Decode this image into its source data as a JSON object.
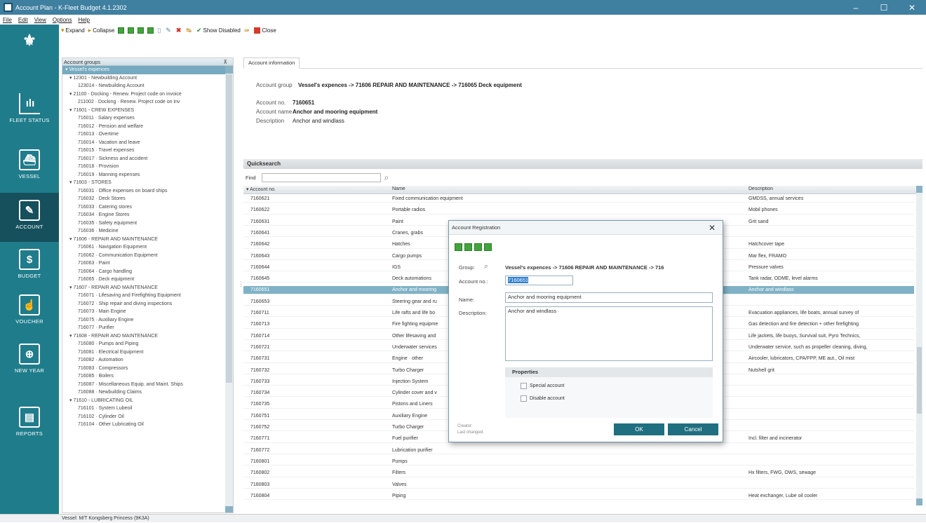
{
  "window": {
    "title": "Account Plan - K-Fleet Budget 4.1.2302",
    "minimize": "–",
    "maximize": "☐",
    "close": "✕"
  },
  "menu": [
    "File",
    "Edit",
    "View",
    "Options",
    "Help"
  ],
  "toolbar": {
    "expand": "Expand",
    "collapse": "Collapse",
    "show_disabled": "Show Disabled",
    "close": "Close"
  },
  "sidebar": [
    {
      "label": "",
      "icon": "crest-icon"
    },
    {
      "label": "FLEET STATUS",
      "icon": "fleet-status-icon"
    },
    {
      "label": "VESSEL",
      "icon": "vessel-icon"
    },
    {
      "label": "ACCOUNT",
      "icon": "account-icon"
    },
    {
      "label": "BUDGET",
      "icon": "budget-icon"
    },
    {
      "label": "VOUCHER",
      "icon": "voucher-icon"
    },
    {
      "label": "NEW YEAR",
      "icon": "new-year-icon"
    },
    {
      "label": "REPORTS",
      "icon": "reports-icon"
    }
  ],
  "tree": {
    "header": "Account groups",
    "pin": "⊼",
    "nodes": [
      {
        "indent": 0,
        "label": "▾ Vessel's expences",
        "selected": true
      },
      {
        "indent": 1,
        "label": "▾ 12301 - Newbuilding Account"
      },
      {
        "indent": 3,
        "label": "123014 - Newbuilding Account"
      },
      {
        "indent": 1,
        "label": "▾ 21100 - Docking - Renew. Project code on invoice"
      },
      {
        "indent": 3,
        "label": "211002 · Docking · Renew. Project code on inv"
      },
      {
        "indent": 1,
        "label": "▾ 71601 - CREW EXPENSES"
      },
      {
        "indent": 3,
        "label": "716011 · Salary expenses"
      },
      {
        "indent": 3,
        "label": "716012 · Pension and welfare"
      },
      {
        "indent": 3,
        "label": "716013 · Overtime"
      },
      {
        "indent": 3,
        "label": "716014 · Vacation and leave"
      },
      {
        "indent": 3,
        "label": "716015 · Travel expenses"
      },
      {
        "indent": 3,
        "label": "716017 · Sickness and accident"
      },
      {
        "indent": 3,
        "label": "716018 · Provision"
      },
      {
        "indent": 3,
        "label": "716019 · Manning expenses"
      },
      {
        "indent": 1,
        "label": "▾ 71603 - STORES"
      },
      {
        "indent": 3,
        "label": "716031 · Office expenses on board ships"
      },
      {
        "indent": 3,
        "label": "716032 · Deck Stores"
      },
      {
        "indent": 3,
        "label": "716033 · Catering stores"
      },
      {
        "indent": 3,
        "label": "716034 · Engine Stores"
      },
      {
        "indent": 3,
        "label": "716035 · Safety equipment"
      },
      {
        "indent": 3,
        "label": "716036 · Medicine"
      },
      {
        "indent": 1,
        "label": "▾ 71606 - REPAIR AND MAINTENANCE"
      },
      {
        "indent": 3,
        "label": "716061 · Navigation Equipment"
      },
      {
        "indent": 3,
        "label": "716062 · Communication Equipment"
      },
      {
        "indent": 3,
        "label": "716063 · Paint"
      },
      {
        "indent": 3,
        "label": "716064 · Cargo handling"
      },
      {
        "indent": 3,
        "label": "716065 · Deck equipment"
      },
      {
        "indent": 1,
        "label": "▾ 71607 - REPAIR AND MAINTENANCE"
      },
      {
        "indent": 3,
        "label": "716071 · Lifesaving and Firefighting Equipment"
      },
      {
        "indent": 3,
        "label": "716072 · Ship repair and diving inspections"
      },
      {
        "indent": 3,
        "label": "716073 · Main Engine"
      },
      {
        "indent": 3,
        "label": "716075 · Auxiliary Engine"
      },
      {
        "indent": 3,
        "label": "716077 · Purifier"
      },
      {
        "indent": 1,
        "label": "▾ 71608 - REPAIR AND MAINTENANCE"
      },
      {
        "indent": 3,
        "label": "716080 · Pumps and Piping"
      },
      {
        "indent": 3,
        "label": "716081 · Electrical Equipment"
      },
      {
        "indent": 3,
        "label": "716082 · Automation"
      },
      {
        "indent": 3,
        "label": "716083 · Compressors"
      },
      {
        "indent": 3,
        "label": "716085 · Boilers"
      },
      {
        "indent": 3,
        "label": "716087 · Miscellaneous Equip. and Maint. Ships"
      },
      {
        "indent": 3,
        "label": "716088 · Newbuilding Claims"
      },
      {
        "indent": 1,
        "label": "▾ 71610 - LUBRICATING OIL"
      },
      {
        "indent": 3,
        "label": "716101 · System Lubeoil"
      },
      {
        "indent": 3,
        "label": "716102 · Cylinder Oil"
      },
      {
        "indent": 3,
        "label": "716104 · Other Lubricating Oil"
      }
    ]
  },
  "info_tab": "Account information",
  "info": {
    "group_label": "Account group",
    "group_value": "Vessel's expences -> 71606  REPAIR AND MAINTENANCE -> 716065  Deck equipment",
    "no_label": "Account no.",
    "no_value": "7160651",
    "name_label": "Account name",
    "name_value": "Anchor and mooring equipment",
    "desc_label": "Description",
    "desc_value": "Anchor and windlass"
  },
  "quicksearch": {
    "title": "Quicksearch",
    "find_label": "Find",
    "find_value": "",
    "search_icon": "⌕"
  },
  "grid": {
    "columns": [
      "▾ Account no.",
      "Name",
      "Description"
    ],
    "rows": [
      [
        "7160621",
        "Fixed communication equipment",
        "GMDSS, annual services"
      ],
      [
        "7160622",
        "Portable radios",
        "Mobil phones"
      ],
      [
        "7160631",
        "Paint",
        "Grit sand"
      ],
      [
        "7160641",
        "Cranes, grabs",
        ""
      ],
      [
        "7160642",
        "Hatches",
        "Hatchcover tape"
      ],
      [
        "7160643",
        "Cargo pumps",
        "Mar flex, FRAMO"
      ],
      [
        "7160644",
        "IGS",
        "Pressure valves"
      ],
      [
        "7160645",
        "Deck automations",
        "Tank radar, ODME, level alarms"
      ],
      [
        "7160651",
        "Anchor and mooring",
        "Anchor and windlass"
      ],
      [
        "7160653",
        "Steering gear and ru",
        ""
      ],
      [
        "7160711",
        "Life rafts and life bo",
        "Evacuation appliances, life boats, annual survey of"
      ],
      [
        "7160713",
        "Fire fighting equipme",
        "Gas detection and fire detection + other firefighting"
      ],
      [
        "7160714",
        "Other lifesaving and",
        "Life jackets, life buoys, Survival suit, Pyro Technics,"
      ],
      [
        "7160721",
        "Underwater services",
        "Underwater service, such as propeller cleaning, diving,"
      ],
      [
        "7160731",
        "Engine · other",
        "Aircooler, lubricators, CPA/FPP, ME aut., Oil mist"
      ],
      [
        "7160732",
        "Turbo Charger",
        "Nutshell grit"
      ],
      [
        "7160733",
        "Injection System",
        ""
      ],
      [
        "7160734",
        "Cylinder cover and v",
        ""
      ],
      [
        "7160735",
        "Pistons and Liners",
        ""
      ],
      [
        "7160751",
        "Auxiliary Engine",
        ""
      ],
      [
        "7160752",
        "Turbo Charger",
        ""
      ],
      [
        "7160771",
        "Fuel purifier",
        "Incl. filter and incinerator"
      ],
      [
        "7160772",
        "Lubrication purifier",
        ""
      ],
      [
        "7160801",
        "Pumps",
        ""
      ],
      [
        "7160802",
        "Filters",
        "Hx filters, FWG, OWS, sewage"
      ],
      [
        "7160803",
        "Valves",
        ""
      ],
      [
        "7160804",
        "Piping",
        "Heat exchanger, Lube oil cooler"
      ]
    ],
    "selected_row": 8
  },
  "status": "Vessel: M/T Kongsberg Princess (9K3A)",
  "dialog": {
    "title": "Account Registration",
    "close": "✕",
    "group_label": "Group:",
    "group_value": "Vessel's expences -> 71606  REPAIR AND MAINTENANCE -> 716",
    "accno_label": "Account no.:",
    "accno_value": "7160651",
    "name_label": "Name:",
    "name_value": "Anchor and mooring equipment",
    "desc_label": "Description:",
    "desc_value": "Anchor and windlass",
    "props_title": "Properties",
    "special": "Special account",
    "disable": "Disable account",
    "ok": "OK",
    "cancel": "Cancel",
    "foot1": "Creator:",
    "foot2": "Last changed:"
  }
}
